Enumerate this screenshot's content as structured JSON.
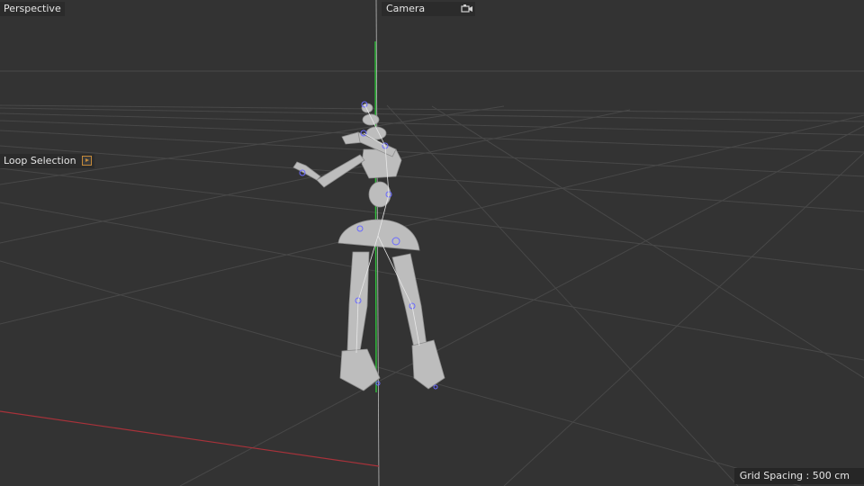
{
  "viewport": {
    "view_name": "Perspective",
    "camera_label": "Camera",
    "camera_icon": "camera-icon",
    "loop_selection_label": "Loop Selection",
    "loop_selection_icon": "play-icon",
    "grid_spacing_text": "Grid Spacing : 500 cm"
  },
  "colors": {
    "background": "#333333",
    "grid_line": "#4a4a4a",
    "x_axis": "#a8323a",
    "y_axis": "#2ec03a",
    "z_axis_guide": "#bbbbbb",
    "model": "#bdbdbd",
    "joint": "#6a6aff"
  }
}
